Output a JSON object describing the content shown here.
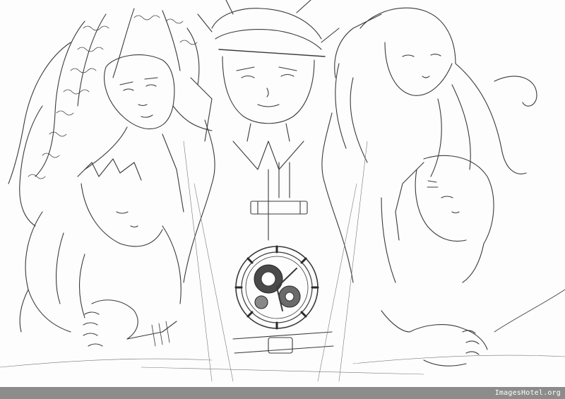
{
  "image": {
    "description_kind": "pencil sketch illustration",
    "background_color": "#fdfdfd",
    "line_color": "#3a3a3a"
  },
  "footer": {
    "bar_color": "#8c8c8c",
    "watermark": "ImagesHotel.org"
  }
}
